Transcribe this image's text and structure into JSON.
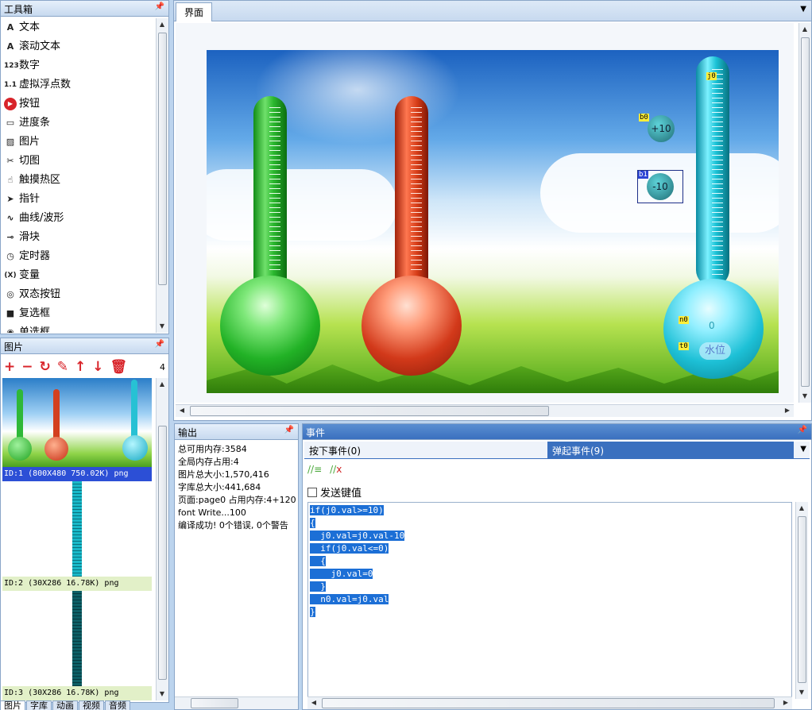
{
  "toolbox": {
    "title": "工具箱",
    "items": [
      {
        "icon": "text-icon",
        "glyph": "A",
        "label": "文本"
      },
      {
        "icon": "scroll-text-icon",
        "glyph": "A",
        "label": "滚动文本"
      },
      {
        "icon": "number-icon",
        "glyph": "123",
        "label": "数字"
      },
      {
        "icon": "float-icon",
        "glyph": "1.1",
        "label": "虚拟浮点数"
      },
      {
        "icon": "button-icon",
        "glyph": "▶",
        "label": "按钮"
      },
      {
        "icon": "progress-icon",
        "glyph": "▭",
        "label": "进度条"
      },
      {
        "icon": "picture-icon",
        "glyph": "▨",
        "label": "图片"
      },
      {
        "icon": "scissors-icon",
        "glyph": "✂",
        "label": "切图"
      },
      {
        "icon": "hand-icon",
        "glyph": "☝",
        "label": "触摸热区"
      },
      {
        "icon": "pointer-icon",
        "glyph": "➤",
        "label": "指针"
      },
      {
        "icon": "wave-icon",
        "glyph": "∿",
        "label": "曲线/波形"
      },
      {
        "icon": "slider-icon",
        "glyph": "⊸",
        "label": "滑块"
      },
      {
        "icon": "clock-icon",
        "glyph": "◷",
        "label": "定时器"
      },
      {
        "icon": "variable-icon",
        "glyph": "(X)",
        "label": "变量"
      },
      {
        "icon": "dual-button-icon",
        "glyph": "◎",
        "label": "双态按钮"
      },
      {
        "icon": "checkbox-icon",
        "glyph": "■",
        "label": "复选框"
      },
      {
        "icon": "radio-icon",
        "glyph": "◉",
        "label": "单选框"
      }
    ]
  },
  "pictures": {
    "title": "图片",
    "count": "4",
    "items": [
      {
        "label": "ID:1  (800X480 750.02K) png"
      },
      {
        "label": "ID:2  (30X286 16.78K) png"
      },
      {
        "label": "ID:3  (30X286 16.78K) png"
      }
    ]
  },
  "bottom_tabs": [
    "图片",
    "字库",
    "动画",
    "视频",
    "音频"
  ],
  "canvas": {
    "title": "界面",
    "tags": {
      "j0": "j0",
      "b0": "b0",
      "b1": "b1",
      "n0": "n0",
      "t0": "t0"
    },
    "b0_text": "+10",
    "b1_text": "-10",
    "n0_text": "0",
    "t0_text": "水位"
  },
  "output": {
    "title": "输出",
    "lines": [
      "总可用内存:3584",
      "全局内存占用:4",
      "图片总大小:1,570,416",
      "字库总大小:441,684",
      "页面:page0 占用内存:4+120",
      "font Write...100",
      "编译成功! 0个错误, 0个警告"
    ]
  },
  "events": {
    "title": "事件",
    "tab_press": "按下事件(0)",
    "tab_release": "弹起事件(9)",
    "send_key": "发送键值",
    "code": [
      "if(j0.val>=10)",
      "{",
      "  j0.val=j0.val-10",
      "  if(j0.val<=0)",
      "  {",
      "    j0.val=0",
      "  }",
      "  n0.val=j0.val",
      "}"
    ]
  }
}
